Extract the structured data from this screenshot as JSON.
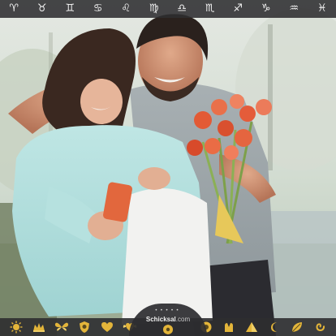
{
  "top_bar": {
    "signs": [
      {
        "symbol": "♈",
        "icon": "aries-icon"
      },
      {
        "symbol": "♉",
        "icon": "taurus-icon"
      },
      {
        "symbol": "♊",
        "icon": "gemini-icon"
      },
      {
        "symbol": "♋",
        "icon": "cancer-icon"
      },
      {
        "symbol": "♌",
        "icon": "leo-icon"
      },
      {
        "symbol": "♍",
        "icon": "virgo-icon"
      },
      {
        "symbol": "♎",
        "icon": "libra-icon"
      },
      {
        "symbol": "♏",
        "icon": "scorpio-icon"
      },
      {
        "symbol": "♐",
        "icon": "sagittarius-icon"
      },
      {
        "symbol": "♑",
        "icon": "capricorn-icon"
      },
      {
        "symbol": "♒",
        "icon": "aquarius-icon"
      },
      {
        "symbol": "♓",
        "icon": "pisces-icon"
      }
    ]
  },
  "bottom_bar": {
    "left_icons": [
      "sun-icon",
      "tiara-icon",
      "butterfly-icon",
      "shield-icon",
      "heart-icon",
      "winged-heart-icon"
    ],
    "right_icons": [
      "emblem-icon",
      "hands-icon",
      "pyramid-icon",
      "crescent-moon-icon",
      "leaf-icon",
      "swirl-icon"
    ],
    "logo": {
      "brand": "Schicksal",
      "domain": ".com"
    },
    "accent_color": "#e3b53a"
  }
}
